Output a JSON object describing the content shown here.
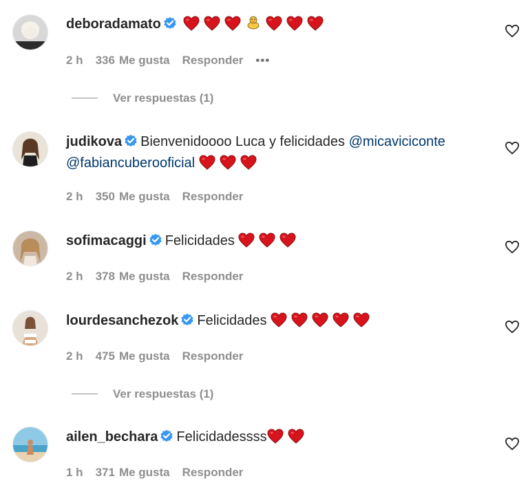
{
  "like_label": "Me gusta",
  "reply_label": "Responder",
  "more_label": "•••",
  "comments": [
    {
      "username": "deboradamato",
      "text": "",
      "mention1": "",
      "mention2": "",
      "time": "2 h",
      "likes": "336",
      "replies_label": "Ver respuestas (1)",
      "emojis": "hearts-with-duck"
    },
    {
      "username": "judikova",
      "text": "Bienvenidoooo Luca y felicidades",
      "mention1": "@micaviciconte",
      "mention2": "@fabiancuberooficial",
      "time": "2 h",
      "likes": "350",
      "emojis": "3 hearts"
    },
    {
      "username": "sofimacaggi",
      "text": "Felicidades",
      "time": "2 h",
      "likes": "378",
      "emojis": "3 hearts"
    },
    {
      "username": "lourdesanchezok",
      "text": "Felicidades",
      "time": "2 h",
      "likes": "475",
      "replies_label": "Ver respuestas (1)",
      "emojis": "5 hearts"
    },
    {
      "username": "ailen_bechara",
      "text": "Felicidadessss",
      "time": "1 h",
      "likes": "371",
      "emojis": "2 hearts"
    }
  ],
  "colors": {
    "verified": "#3897f0",
    "heart": "#d7141c",
    "mention": "#00376b",
    "meta": "#8e8e8e"
  },
  "icons": {
    "verified": "verified-badge-icon",
    "like": "heart-outline-icon",
    "emoji": "red-heart-emoji",
    "duck": "duck-emoji"
  }
}
